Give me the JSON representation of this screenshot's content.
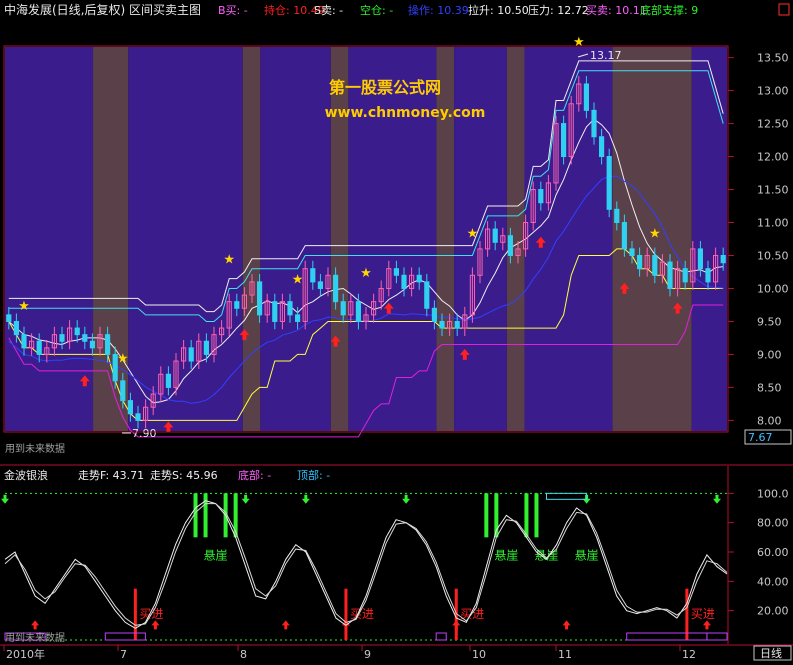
{
  "colors": {
    "background": "#000000",
    "panel_purple": "#3a1c8c",
    "panel_brown": "#5a4048",
    "frame": "#b01030",
    "axis_text": "#c8c8c8",
    "bull": "#ff60b0",
    "bear": "#30d0f0",
    "cyan_line": "#40e0f0",
    "white_line": "#f0f0f0",
    "yellow_line": "#ffff40",
    "magenta_line": "#e020e0",
    "blue_line": "#3040ff",
    "buy_red": "#ff2020",
    "signal_green": "#30f030",
    "violet": "#c040ff",
    "label_orange": "#ffd700"
  },
  "header": {
    "title": "中海发展(日线,后复权) 区间买卖主图",
    "items": [
      {
        "label": "B买: -",
        "color": "#ff60ff"
      },
      {
        "label": "持仓: 10.49",
        "color": "#ff2020"
      },
      {
        "label": "S卖: -",
        "color": "#f0f0f0"
      },
      {
        "label": "空仓: -",
        "color": "#30f030"
      },
      {
        "label": "操作: 10.39",
        "color": "#3040ff"
      },
      {
        "label": "拉升: 10.50",
        "color": "#f0f0f0"
      },
      {
        "label": "压力: 12.72",
        "color": "#f0f0f0"
      },
      {
        "label": "买卖: 10.11",
        "color": "#ff60ff"
      },
      {
        "label": "底部支撑: 9",
        "color": "#30f030"
      }
    ]
  },
  "watermark": {
    "line1": "第一股票公式网",
    "line2": "www.chnmoney.com"
  },
  "main_panel": {
    "future_label": "用到未来数据",
    "high_label": "13.17",
    "low_label": "7.90",
    "current_price": "7.67",
    "yticks": [
      "13.50",
      "13.00",
      "12.50",
      "12.00",
      "11.50",
      "11.00",
      "10.50",
      "10.00",
      "9.50",
      "9.00",
      "8.50",
      "8.00"
    ]
  },
  "sub_panel": {
    "name": "金波银浪",
    "f_label": "走势F: 43.71",
    "s_label": "走势S: 45.96",
    "bottom_label": "底部: -",
    "top_label": "顶部: -",
    "yticks": [
      "100.0",
      "80.00",
      "60.00",
      "40.00",
      "20.00"
    ],
    "buy_text": "买进",
    "cliff_text": "悬崖",
    "future_label": "用到未来数据"
  },
  "xaxis": {
    "labels": [
      "2010年",
      "7",
      "8",
      "9",
      "10",
      "11",
      "12"
    ],
    "period": "日线"
  },
  "chart_data": [
    {
      "type": "candlestick",
      "title": "中海发展(日线,后复权) 区间买卖主图",
      "ylim": [
        7.9,
        13.6
      ],
      "grid": false,
      "bands": [
        "purple",
        "brown",
        "purple",
        "brown",
        "purple",
        "brown",
        "purple",
        "brown",
        "purple",
        "brown",
        "purple",
        "brown",
        "purple"
      ],
      "closes": [
        9.5,
        9.3,
        9.1,
        9.2,
        9.0,
        9.1,
        9.3,
        9.2,
        9.4,
        9.3,
        9.2,
        9.1,
        9.3,
        9.0,
        8.6,
        8.3,
        8.1,
        8.0,
        8.2,
        8.4,
        8.7,
        8.5,
        8.9,
        9.1,
        8.9,
        9.2,
        9.0,
        9.3,
        9.4,
        9.8,
        9.7,
        9.9,
        10.1,
        9.6,
        9.8,
        9.5,
        9.8,
        9.6,
        9.5,
        10.3,
        10.1,
        10.0,
        10.2,
        9.8,
        9.6,
        9.8,
        9.5,
        9.6,
        9.8,
        10.0,
        10.3,
        10.2,
        10.0,
        10.2,
        10.1,
        9.7,
        9.5,
        9.4,
        9.5,
        9.4,
        9.6,
        10.2,
        10.6,
        10.9,
        10.7,
        10.8,
        10.5,
        10.6,
        11.0,
        11.5,
        11.3,
        11.6,
        12.5,
        12.0,
        12.8,
        13.1,
        12.7,
        12.3,
        12.0,
        11.2,
        11.0,
        10.6,
        10.5,
        10.3,
        10.5,
        10.2,
        10.4,
        10.0,
        10.3,
        10.1,
        10.6,
        10.3,
        10.1,
        10.5,
        10.39
      ]
    },
    {
      "type": "line",
      "title": "金波银浪",
      "ylim": [
        0,
        105
      ],
      "grid": false,
      "series": [
        {
          "name": "走势F",
          "values": [
            55,
            60,
            45,
            30,
            25,
            35,
            45,
            55,
            50,
            40,
            30,
            20,
            12,
            8,
            12,
            25,
            45,
            65,
            80,
            90,
            95,
            93,
            85,
            70,
            50,
            30,
            28,
            40,
            55,
            65,
            60,
            45,
            30,
            15,
            10,
            15,
            30,
            50,
            70,
            82,
            80,
            75,
            65,
            50,
            30,
            15,
            12,
            25,
            50,
            75,
            85,
            80,
            70,
            60,
            55,
            65,
            80,
            90,
            85,
            70,
            50,
            30,
            20,
            18,
            20,
            22,
            20,
            15,
            25,
            45,
            58,
            50,
            45
          ]
        },
        {
          "name": "走势S",
          "values": [
            52,
            58,
            48,
            34,
            28,
            33,
            43,
            52,
            51,
            43,
            33,
            23,
            15,
            10,
            11,
            22,
            40,
            60,
            76,
            87,
            93,
            93,
            87,
            74,
            55,
            35,
            30,
            37,
            52,
            62,
            61,
            48,
            33,
            18,
            12,
            14,
            27,
            46,
            66,
            79,
            80,
            76,
            67,
            53,
            34,
            18,
            13,
            22,
            45,
            70,
            82,
            81,
            72,
            62,
            56,
            62,
            76,
            87,
            86,
            73,
            54,
            34,
            23,
            19,
            19,
            21,
            21,
            17,
            22,
            40,
            54,
            52,
            46
          ]
        }
      ]
    }
  ]
}
